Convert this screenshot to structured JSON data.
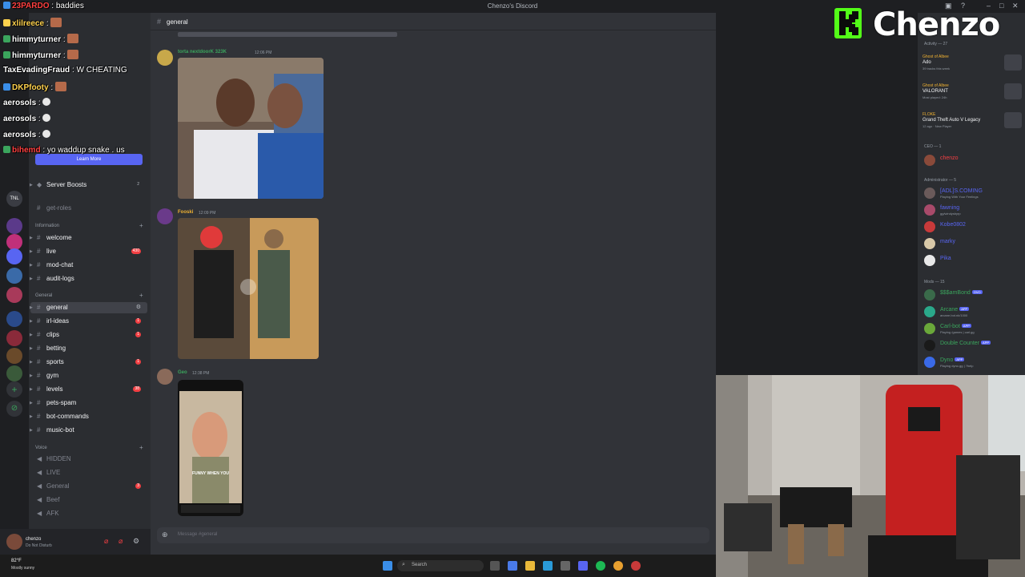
{
  "window": {
    "title": "Chenzo's Discord"
  },
  "brand": {
    "text": "Chenzo",
    "accent": "#53fc18"
  },
  "stream_chat": [
    {
      "user": "23PARDO",
      "text": "baddies",
      "color": "#ff4040"
    },
    {
      "user": "xlilreece",
      "text": "",
      "color": "#ffd24d"
    },
    {
      "user": "himmyturner",
      "text": "",
      "color": "#ffffff"
    },
    {
      "user": "himmyturner",
      "text": "",
      "color": "#ffffff"
    },
    {
      "user": "TaxEvadingFraud",
      "text": "W CHEATING",
      "color": "#ffffff"
    },
    {
      "user": "DKPfooty",
      "text": "",
      "color": "#ffd24d"
    },
    {
      "user": "aerosols",
      "text": "",
      "color": "#ffffff"
    },
    {
      "user": "aerosols",
      "text": "",
      "color": "#ffffff"
    },
    {
      "user": "aerosols",
      "text": "",
      "color": "#ffffff"
    },
    {
      "user": "bihemd",
      "text": "yo waddup snake . us",
      "color": "#ff4040"
    }
  ],
  "sidebar": {
    "learn_more": "Learn More",
    "server_boosts": {
      "label": "Server Boosts",
      "count": "2"
    },
    "get_roles": "get-roles",
    "categories": {
      "information": "Information",
      "general": "General",
      "voice": "Voice"
    },
    "info_channels": [
      {
        "name": "welcome",
        "badge": ""
      },
      {
        "name": "live",
        "badge": "430"
      },
      {
        "name": "mod-chat",
        "badge": ""
      },
      {
        "name": "audit-logs",
        "badge": ""
      }
    ],
    "general_channels": [
      {
        "name": "general",
        "badge": ""
      },
      {
        "name": "irl-ideas",
        "badge": "1"
      },
      {
        "name": "clips",
        "badge": "1"
      },
      {
        "name": "betting",
        "badge": ""
      },
      {
        "name": "sports",
        "badge": "1"
      },
      {
        "name": "gym",
        "badge": ""
      },
      {
        "name": "levels",
        "badge": "38"
      },
      {
        "name": "pets-spam",
        "badge": ""
      },
      {
        "name": "bot-commands",
        "badge": ""
      },
      {
        "name": "music-bot",
        "badge": ""
      }
    ],
    "voice_channels": [
      {
        "name": "HIDDEN",
        "badge": ""
      },
      {
        "name": "LIVE",
        "badge": ""
      },
      {
        "name": "General",
        "badge": "3"
      },
      {
        "name": "Beef",
        "badge": ""
      },
      {
        "name": "AFK",
        "badge": ""
      }
    ],
    "user": {
      "name": "chenzo",
      "status": "Do Not Disturb"
    }
  },
  "chat": {
    "channel": "general",
    "messages": [
      {
        "name": "torta nextdoorK 323K",
        "time": "12:06 PM",
        "color": "#3ba55d"
      },
      {
        "name": "Fooski",
        "time": "12:09 PM",
        "color": "#f0b232"
      },
      {
        "name": "Geo",
        "time": "12:38 PM",
        "color": "#3ba55d"
      }
    ],
    "video_caption": "FUNNY WHEN YOU",
    "input_placeholder": "Message #general"
  },
  "members": {
    "activity_header": "Activity — 27",
    "activities": [
      {
        "game": "Ghost of Albee",
        "title": "Ado",
        "sub": "39 tracks this week"
      },
      {
        "game": "Ghost of Albee",
        "title": "VALORANT",
        "sub": "Most played: 24h"
      },
      {
        "game": "FLOKE",
        "title": "Grand Theft Auto V Legacy",
        "sub": "12 ago · New Player"
      }
    ],
    "ceo_header": "CEO — 1",
    "ceo": [
      {
        "name": "chenzo",
        "sub": "",
        "color": "#f23f43",
        "tag": ""
      }
    ],
    "admin_header": "Administrator — 5",
    "admins": [
      {
        "name": "[ADL]S.COMING",
        "sub": "Playing With Your Feelings",
        "color": "#5865f2",
        "tag": ""
      },
      {
        "name": "fawning",
        "sub": "gg/windysbyrp",
        "color": "#5865f2",
        "tag": ""
      },
      {
        "name": "Kobe0802",
        "sub": "",
        "color": "#5865f2",
        "tag": ""
      },
      {
        "name": "marky",
        "sub": "",
        "color": "#5865f2",
        "tag": ""
      },
      {
        "name": "Pika",
        "sub": "",
        "color": "#5865f2",
        "tag": ""
      }
    ],
    "mods_header": "Mods — 15",
    "mods": [
      {
        "name": "$$$amBond",
        "sub": "",
        "color": "#3ba55d",
        "tag": "OVO"
      },
      {
        "name": "Arcane",
        "sub": "arcane.bot.nk/1000",
        "color": "#3ba55d",
        "tag": "APP"
      },
      {
        "name": "Carl-bot",
        "sub": "Playing /games | carl.gg",
        "color": "#3ba55d",
        "tag": "APP"
      },
      {
        "name": "Double Counter",
        "sub": "",
        "color": "#3ba55d",
        "tag": "APP"
      },
      {
        "name": "Dyno",
        "sub": "Playing dyno.gg | ?help",
        "color": "#3ba55d",
        "tag": "APP"
      }
    ]
  },
  "taskbar": {
    "weather_temp": "82°F",
    "weather_desc": "Mostly sunny",
    "search": "Search"
  }
}
